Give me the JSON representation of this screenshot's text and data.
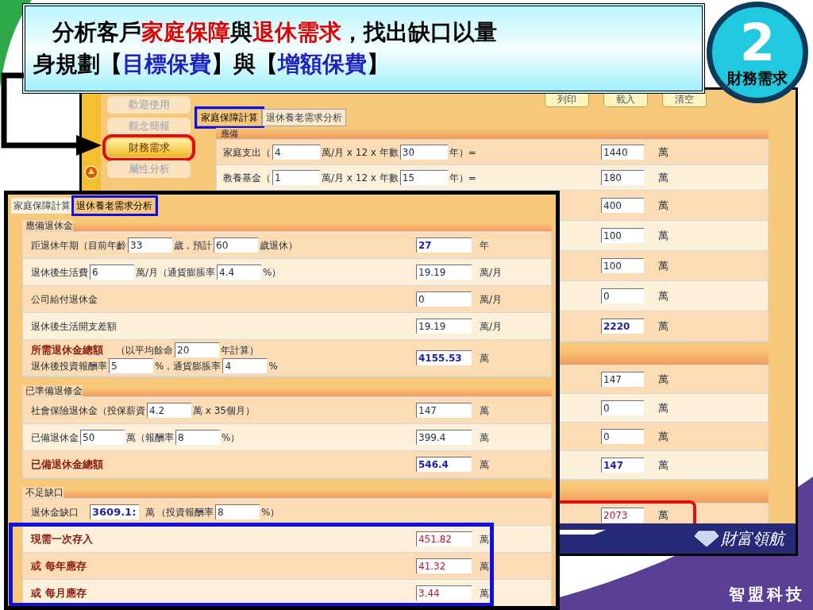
{
  "title": {
    "lines": [
      [
        {
          "text": "分析客戶",
          "color": "#000000"
        },
        {
          "text": "家庭保障",
          "color": "#e00000"
        },
        {
          "text": "與",
          "color": "#000000"
        },
        {
          "text": "退休需求",
          "color": "#e00000"
        },
        {
          "text": "，找出缺口以量",
          "color": "#000000"
        }
      ],
      [
        {
          "text": "身規劃【",
          "color": "#000000"
        },
        {
          "text": "目標保費",
          "color": "#2020c0"
        },
        {
          "text": "】與【",
          "color": "#000000"
        },
        {
          "text": "增額保費",
          "color": "#2020c0"
        },
        {
          "text": "】",
          "color": "#000000"
        }
      ]
    ]
  },
  "badge": {
    "number": "2",
    "label": "財務需求"
  },
  "back_window": {
    "sidebar": [
      {
        "label": "歡迎使用",
        "selected": false,
        "boxed": false
      },
      {
        "label": "觀念簡報",
        "selected": false,
        "boxed": false
      },
      {
        "label": "財務需求",
        "selected": true,
        "boxed": true
      },
      {
        "label": "屬性分析",
        "selected": false,
        "boxed": false
      }
    ],
    "buttons": [
      "列印",
      "載入",
      "清空"
    ],
    "tabs": [
      {
        "label": "家庭保障計算",
        "selected": true,
        "boxed": true
      },
      {
        "label": "退休養老需求分析",
        "selected": false,
        "boxed": false
      }
    ],
    "sections": [
      {
        "title": "應備",
        "rows": [
          {
            "parts": [
              {
                "kind": "text",
                "text": "家庭支出（"
              },
              {
                "kind": "input",
                "text": "4"
              },
              {
                "kind": "text",
                "text": "萬/月 x 12 x 年數"
              },
              {
                "kind": "input",
                "text": "30"
              },
              {
                "kind": "text",
                "text": "年）="
              }
            ],
            "value": "1440",
            "kind": "plain",
            "unit": "萬",
            "boxed": false
          },
          {
            "parts": [
              {
                "kind": "text",
                "text": "教養基金（"
              },
              {
                "kind": "input",
                "text": "1"
              },
              {
                "kind": "text",
                "text": "萬/月 x 12 x 年數"
              },
              {
                "kind": "input",
                "text": "15"
              },
              {
                "kind": "text",
                "text": "年）="
              }
            ],
            "value": "180",
            "kind": "plain",
            "unit": "萬",
            "boxed": false
          },
          {
            "value": "400",
            "kind": "plain",
            "unit": "萬",
            "boxed": false
          },
          {
            "value": "100",
            "kind": "plain",
            "unit": "萬",
            "boxed": false
          },
          {
            "value": "100",
            "kind": "plain",
            "unit": "萬",
            "boxed": false
          },
          {
            "value": "0",
            "kind": "plain",
            "unit": "萬",
            "boxed": false
          },
          {
            "value": "2220",
            "kind": "total",
            "unit": "萬",
            "boxed": false
          }
        ]
      },
      {
        "rows": [
          {
            "value": "147",
            "kind": "plain",
            "unit": "萬",
            "boxed": false
          },
          {
            "value": "0",
            "kind": "plain",
            "unit": "萬",
            "boxed": false
          },
          {
            "value": "0",
            "kind": "plain",
            "unit": "萬",
            "boxed": false
          },
          {
            "value": "147",
            "kind": "total",
            "unit": "萬",
            "boxed": false
          }
        ]
      },
      {
        "rows": [
          {
            "value": "2073",
            "kind": "gap",
            "unit": "萬",
            "boxed": true
          }
        ]
      }
    ],
    "logo": "財富領航"
  },
  "front_window": {
    "tabs": [
      {
        "label": "家庭保障計算",
        "selected": false,
        "boxed": false
      },
      {
        "label": "退休養老需求分析",
        "selected": true,
        "boxed": true
      }
    ],
    "sections": [
      {
        "title": "應備退休金",
        "rows": [
          {
            "lines": [
              [
                {
                  "kind": "text",
                  "text": "距退休年期（目前年齡"
                },
                {
                  "kind": "input",
                  "text": "33"
                },
                {
                  "kind": "text",
                  "text": "歲，預計"
                },
                {
                  "kind": "input",
                  "text": "60"
                },
                {
                  "kind": "text",
                  "text": "歲退休）"
                }
              ]
            ],
            "value": "27",
            "kind": "total",
            "unit": "年",
            "boxed": false
          },
          {
            "lines": [
              [
                {
                  "kind": "text",
                  "text": "退休後生活費"
                },
                {
                  "kind": "input",
                  "text": "6"
                },
                {
                  "kind": "text",
                  "text": "萬/月（通貨膨脹率"
                },
                {
                  "kind": "input",
                  "text": "4.4"
                },
                {
                  "kind": "text",
                  "text": "%）"
                }
              ]
            ],
            "value": "19.19",
            "kind": "plain",
            "unit": "萬/月",
            "boxed": false
          },
          {
            "lines": [
              [
                {
                  "kind": "text",
                  "text": "公司給付退休金"
                }
              ]
            ],
            "value": "0",
            "kind": "plain",
            "unit": "萬/月",
            "boxed": false
          },
          {
            "lines": [
              [
                {
                  "kind": "text",
                  "text": "退休後生活開支差額"
                }
              ]
            ],
            "value": "19.19",
            "kind": "plain",
            "unit": "萬/月",
            "boxed": false
          },
          {
            "lines": [
              [
                {
                  "kind": "strong",
                  "text": "所需退休金總額"
                },
                {
                  "kind": "text",
                  "text": "（以平均餘命"
                },
                {
                  "kind": "input",
                  "text": "20"
                },
                {
                  "kind": "text",
                  "text": "年計算）"
                }
              ],
              [
                {
                  "kind": "text",
                  "text": "退休後投資報酬率"
                },
                {
                  "kind": "input",
                  "text": "5"
                },
                {
                  "kind": "text",
                  "text": "%，通貨膨脹率"
                },
                {
                  "kind": "input",
                  "text": "4"
                },
                {
                  "kind": "text",
                  "text": "%"
                }
              ]
            ],
            "value": "4155.53",
            "kind": "total",
            "unit": "萬",
            "boxed": false
          }
        ]
      },
      {
        "title": "已準備退修金",
        "rows": [
          {
            "lines": [
              [
                {
                  "kind": "text",
                  "text": "社會保險退休金（投保薪資"
                },
                {
                  "kind": "input",
                  "text": "4.2"
                },
                {
                  "kind": "text",
                  "text": "萬 x 35個月）"
                }
              ]
            ],
            "value": "147",
            "kind": "plain",
            "unit": "萬",
            "boxed": false
          },
          {
            "lines": [
              [
                {
                  "kind": "text",
                  "text": "已備退休金"
                },
                {
                  "kind": "input",
                  "text": "50"
                },
                {
                  "kind": "text",
                  "text": "萬（報酬率"
                },
                {
                  "kind": "input",
                  "text": "8"
                },
                {
                  "kind": "text",
                  "text": "%）"
                }
              ]
            ],
            "value": "399.4",
            "kind": "plain",
            "unit": "萬",
            "boxed": false
          },
          {
            "lines": [
              [
                {
                  "kind": "strong",
                  "text": "已備退休金總額"
                }
              ]
            ],
            "value": "546.4",
            "kind": "total",
            "unit": "萬",
            "boxed": false
          }
        ]
      },
      {
        "title": "不足缺口",
        "rows": [
          {
            "lines": [
              [
                {
                  "kind": "text",
                  "text": "退休金缺口"
                },
                {
                  "kind": "bigvalue",
                  "text": "3609.1:"
                },
                {
                  "kind": "text",
                  "text": "萬"
                },
                {
                  "kind": "text",
                  "text": "（投資報酬率"
                },
                {
                  "kind": "input",
                  "text": "8"
                },
                {
                  "kind": "text",
                  "text": "%）"
                }
              ]
            ],
            "boxed": false
          },
          {
            "lines": [
              [
                {
                  "kind": "strong",
                  "text": "現需一次存入"
                }
              ]
            ],
            "value": "451.82",
            "kind": "gap",
            "unit": "萬",
            "boxed": true
          },
          {
            "lines": [
              [
                {
                  "kind": "strong",
                  "text": "或 每年應存"
                }
              ]
            ],
            "value": "41.32",
            "kind": "gap",
            "unit": "萬",
            "boxed": true
          },
          {
            "lines": [
              [
                {
                  "kind": "strong",
                  "text": "或 每月應存"
                }
              ]
            ],
            "value": "3.44",
            "kind": "gap",
            "unit": "萬",
            "boxed": true
          }
        ]
      }
    ]
  },
  "company": "智盟科技"
}
